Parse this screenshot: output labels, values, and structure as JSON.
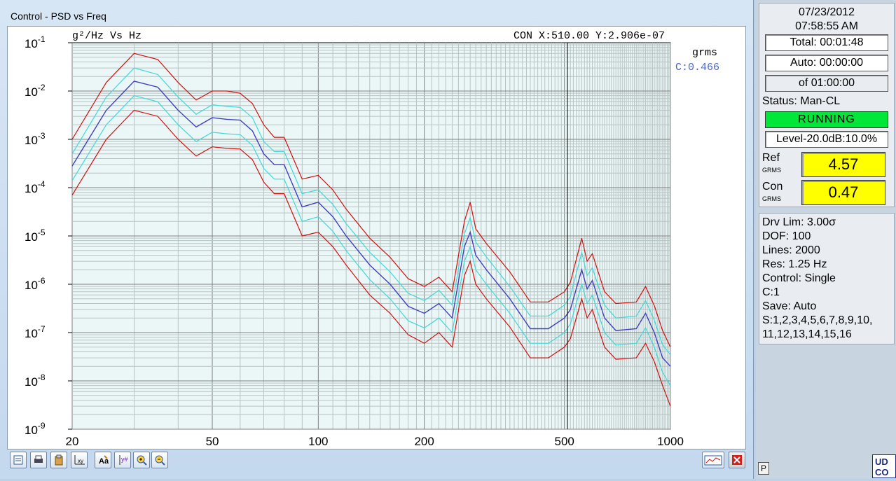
{
  "window": {
    "title": "Control - PSD vs  Freq"
  },
  "plot": {
    "units_label": "g²/Hz Vs Hz",
    "cursor_readout": "CON X:510.00 Y:2.906e-07",
    "grms_label": "grms",
    "grms_value": "C:0.466",
    "y_ticks": [
      "10-1",
      "10-2",
      "10-3",
      "10-4",
      "10-5",
      "10-6",
      "10-7",
      "10-8",
      "10-9"
    ],
    "x_ticks": [
      "20",
      "50",
      "100",
      "200",
      "500",
      "1000"
    ]
  },
  "chart_data": {
    "type": "line",
    "x_scale": "log",
    "y_scale": "log",
    "xlim": [
      20,
      1000
    ],
    "ylim": [
      1e-09,
      0.1
    ],
    "cursor_x": 510,
    "grid": true,
    "x": [
      20,
      25,
      30,
      35,
      40,
      45,
      50,
      55,
      60,
      65,
      70,
      75,
      80,
      90,
      100,
      110,
      120,
      140,
      160,
      180,
      200,
      220,
      240,
      260,
      270,
      280,
      300,
      350,
      400,
      450,
      500,
      520,
      560,
      580,
      600,
      650,
      700,
      800,
      850,
      900,
      950,
      1000
    ],
    "series": [
      {
        "color": "#4040c0",
        "values": [
          0.00028,
          0.004,
          0.016,
          0.012,
          0.004,
          0.0018,
          0.0028,
          0.0026,
          0.0025,
          0.0015,
          0.0005,
          0.0003,
          0.0003,
          4e-05,
          5e-05,
          2.5e-05,
          1e-05,
          2.5e-06,
          1e-06,
          3.5e-07,
          2.5e-07,
          4e-07,
          2e-07,
          6e-06,
          1.2e-05,
          4e-06,
          2e-06,
          5e-07,
          1.2e-07,
          1.2e-07,
          2e-07,
          3e-07,
          2e-06,
          8e-07,
          1.2e-06,
          2e-07,
          1.1e-07,
          1.2e-07,
          2.5e-07,
          1e-07,
          3e-08,
          2e-08
        ]
      },
      {
        "color": "#d01010",
        "values": [
          0.001,
          0.015,
          0.06,
          0.045,
          0.015,
          0.0065,
          0.01,
          0.01,
          0.009,
          0.0055,
          0.002,
          0.0011,
          0.0011,
          0.00015,
          0.00018,
          9e-05,
          3.6e-05,
          9e-06,
          3.6e-06,
          1.3e-06,
          9e-07,
          1.4e-06,
          7e-07,
          2e-05,
          5e-05,
          1.4e-05,
          7e-06,
          1.8e-06,
          4.3e-07,
          4.3e-07,
          7e-07,
          1.1e-06,
          9e-06,
          3e-06,
          4.3e-06,
          7e-07,
          4e-07,
          4.3e-07,
          9e-07,
          3.6e-07,
          1.1e-07,
          5e-08
        ]
      },
      {
        "color": "#d01010",
        "values": [
          7e-05,
          0.001,
          0.004,
          0.003,
          0.001,
          0.00045,
          0.0007,
          0.00065,
          0.00063,
          0.00038,
          0.00013,
          7.5e-05,
          7.5e-05,
          1e-05,
          1.2e-05,
          6e-06,
          2.5e-06,
          6e-07,
          2.5e-07,
          9e-08,
          6e-08,
          1e-07,
          5e-08,
          1.5e-06,
          3e-06,
          1e-06,
          5e-07,
          1.3e-07,
          3e-08,
          3e-08,
          5e-08,
          7.5e-08,
          5e-07,
          2e-07,
          3e-07,
          5e-08,
          2.8e-08,
          3e-08,
          6e-08,
          2.5e-08,
          8e-09,
          3e-09
        ]
      },
      {
        "color": "#40d8d8",
        "values": [
          0.0005,
          0.0075,
          0.03,
          0.022,
          0.0075,
          0.0033,
          0.0052,
          0.0048,
          0.0046,
          0.0028,
          0.0009,
          0.00056,
          0.00056,
          7.5e-05,
          9e-05,
          4.5e-05,
          1.8e-05,
          4.6e-06,
          1.8e-06,
          6.5e-07,
          4.6e-07,
          7.5e-07,
          3.7e-07,
          1.1e-05,
          2.4e-05,
          7.5e-06,
          3.7e-06,
          9e-07,
          2.2e-07,
          2.2e-07,
          3.7e-07,
          5.6e-07,
          4.6e-06,
          1.5e-06,
          2.2e-06,
          3.7e-07,
          2e-07,
          2.2e-07,
          4.6e-07,
          1.8e-07,
          5.6e-08,
          3.5e-08
        ]
      },
      {
        "color": "#40d8d8",
        "values": [
          0.00014,
          0.002,
          0.008,
          0.006,
          0.002,
          0.0009,
          0.0014,
          0.0013,
          0.00125,
          0.00075,
          0.00025,
          0.00015,
          0.00015,
          2e-05,
          2.5e-05,
          1.25e-05,
          5e-06,
          1.25e-06,
          5e-07,
          1.75e-07,
          1.25e-07,
          2e-07,
          1e-07,
          3e-06,
          6e-06,
          2e-06,
          1e-06,
          2.5e-07,
          6e-08,
          6e-08,
          1e-07,
          1.5e-07,
          1e-06,
          4e-07,
          6e-07,
          1e-07,
          5.5e-08,
          6e-08,
          1.25e-07,
          5e-08,
          1.5e-08,
          8e-09
        ]
      }
    ]
  },
  "toolbar": {
    "left_icons": [
      "list-icon",
      "print-icon",
      "clipboard-icon",
      "axis-icon",
      "font-icon",
      "cursor-icon",
      "zoom-in-icon",
      "zoom-out-icon"
    ],
    "right_icons": [
      "chart-window-icon",
      "close-red-icon"
    ]
  },
  "side": {
    "date": "07/23/2012",
    "time": "07:58:55 AM",
    "total": "Total: 00:01:48",
    "auto": "Auto: 00:00:00",
    "of": "of 01:00:00",
    "status": "Status: Man-CL",
    "running": "RUNNING",
    "level": "Level-20.0dB:10.0%",
    "ref_label": "Ref",
    "ref_sub": "GRMS",
    "ref_value": "4.57",
    "con_label": "Con",
    "con_sub": "GRMS",
    "con_value": "0.47",
    "info": [
      "Drv Lim: 3.00σ",
      "DOF: 100",
      "Lines: 2000",
      "Res: 1.25 Hz",
      "Control: Single",
      "C:1",
      "Save: Auto",
      "S:1,2,3,4,5,6,7,8,9,10,",
      "11,12,13,14,15,16"
    ],
    "p_button": "P",
    "logo": "UDCO"
  }
}
